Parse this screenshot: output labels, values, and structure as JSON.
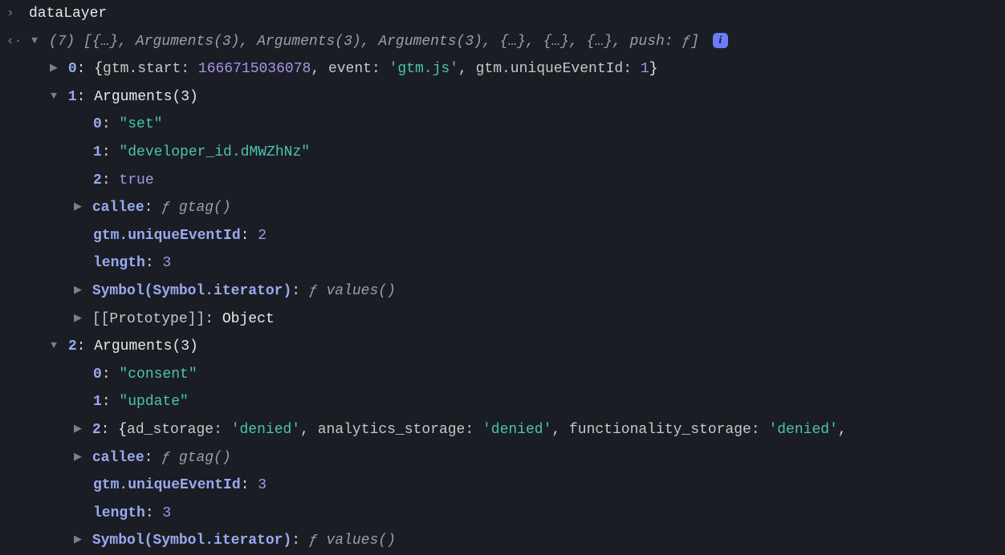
{
  "input": {
    "text": "dataLayer"
  },
  "summary": {
    "count": "(7)",
    "previewParts": [
      "{…}",
      "Arguments(3)",
      "Arguments(3)",
      "Arguments(3)",
      "{…}",
      "{…}",
      "{…}"
    ],
    "pushKey": "push:",
    "pushVal": "ƒ",
    "infoBadge": "i"
  },
  "item0": {
    "index": "0",
    "gtmStartKey": "gtm.start:",
    "gtmStartVal": "1666715036078",
    "eventKey": "event:",
    "eventVal": "'gtm.js'",
    "uidKey": "gtm.uniqueEventId:",
    "uidVal": "1"
  },
  "item1": {
    "index": "1",
    "label": "Arguments(3)",
    "k0": "0",
    "v0": "\"set\"",
    "k1": "1",
    "v1": "\"developer_id.dMWZhNz\"",
    "k2": "2",
    "v2": "true",
    "calleeKey": "callee",
    "calleeVal": "ƒ gtag()",
    "uidKey": "gtm.uniqueEventId",
    "uidVal": "2",
    "lengthKey": "length",
    "lengthVal": "3",
    "symIterKey": "Symbol(Symbol.iterator)",
    "symIterVal": "ƒ values()",
    "protoKey": "[[Prototype]]",
    "protoVal": "Object"
  },
  "item2": {
    "index": "2",
    "label": "Arguments(3)",
    "k0": "0",
    "v0": "\"consent\"",
    "k1": "1",
    "v1": "\"update\"",
    "k2": "2",
    "adKey": "ad_storage:",
    "adVal": "'denied'",
    "anKey": "analytics_storage:",
    "anVal": "'denied'",
    "fnKey": "functionality_storage:",
    "fnVal": "'denied'",
    "calleeKey": "callee",
    "calleeVal": "ƒ gtag()",
    "uidKey": "gtm.uniqueEventId",
    "uidVal": "3",
    "lengthKey": "length",
    "lengthVal": "3",
    "symIterKey": "Symbol(Symbol.iterator)",
    "symIterVal": "ƒ values()"
  }
}
